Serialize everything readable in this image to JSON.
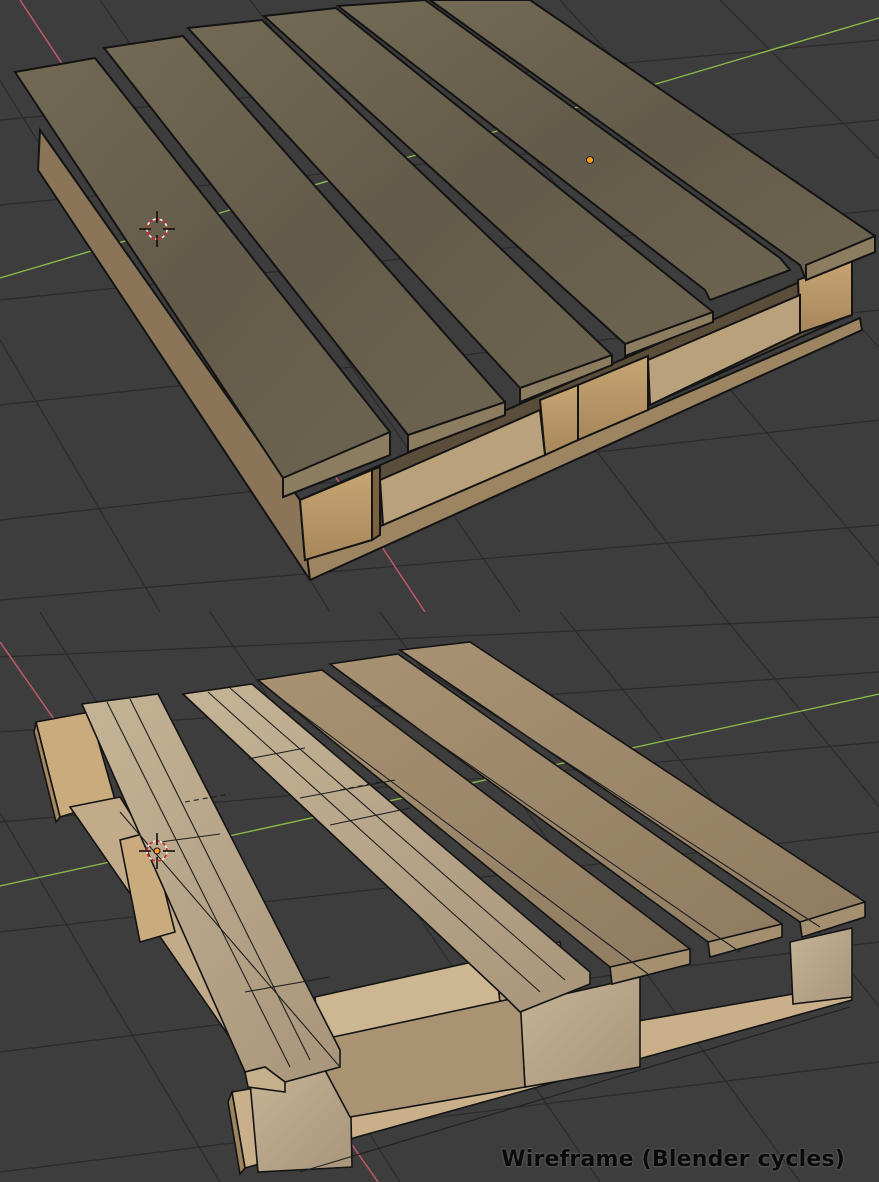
{
  "caption": "Wireframe (Blender cycles)",
  "colors": {
    "background": "#3d3d3d",
    "grid_line": "#2a2a2a",
    "x_axis": "#c85a6e",
    "y_axis": "#8ab84a",
    "wood_top": "#6b6350",
    "wood_light": "#b8a584",
    "wood_block": "#c9ab7e",
    "edge": "#141414",
    "origin_dot": "#ff9d1a"
  },
  "icons": {
    "cursor": "3d-cursor-icon",
    "origin": "origin-point-icon"
  }
}
